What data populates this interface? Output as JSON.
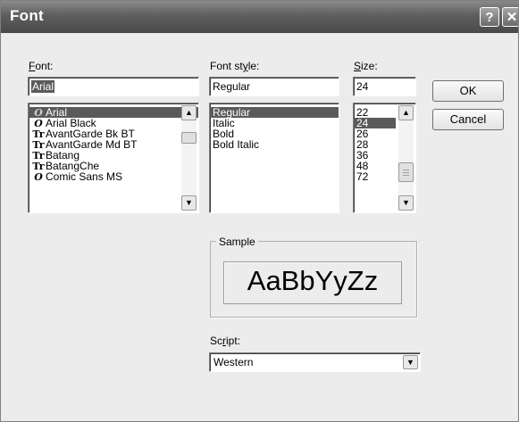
{
  "window": {
    "title": "Font",
    "help_glyph": "?",
    "close_glyph": "✕"
  },
  "font": {
    "label": "Font:",
    "value": "Arial",
    "items": [
      {
        "glyph": "O",
        "glyph_type": "opentype",
        "name": "Arial"
      },
      {
        "glyph": "O",
        "glyph_type": "opentype",
        "name": "Arial Black"
      },
      {
        "glyph": "Tr",
        "glyph_type": "truetype",
        "name": "AvantGarde Bk BT"
      },
      {
        "glyph": "Tr",
        "glyph_type": "truetype",
        "name": "AvantGarde Md BT"
      },
      {
        "glyph": "Tr",
        "glyph_type": "truetype",
        "name": "Batang"
      },
      {
        "glyph": "Tr",
        "glyph_type": "truetype",
        "name": "BatangChe"
      },
      {
        "glyph": "O",
        "glyph_type": "opentype",
        "name": "Comic Sans MS"
      }
    ]
  },
  "style": {
    "label": "Font style:",
    "value": "Regular",
    "items": [
      "Regular",
      "Italic",
      "Bold",
      "Bold Italic"
    ]
  },
  "size": {
    "label": "Size:",
    "value": "24",
    "items": [
      "22",
      "24",
      "26",
      "28",
      "36",
      "48",
      "72"
    ]
  },
  "buttons": {
    "ok": "OK",
    "cancel": "Cancel"
  },
  "sample": {
    "legend": "Sample",
    "text": "AaBbYyZz"
  },
  "script": {
    "label": "Script:",
    "value": "Western"
  },
  "colors": {
    "selection": "#5a5a5a",
    "titlebar": "#5e5e5e",
    "face": "#ececec"
  }
}
